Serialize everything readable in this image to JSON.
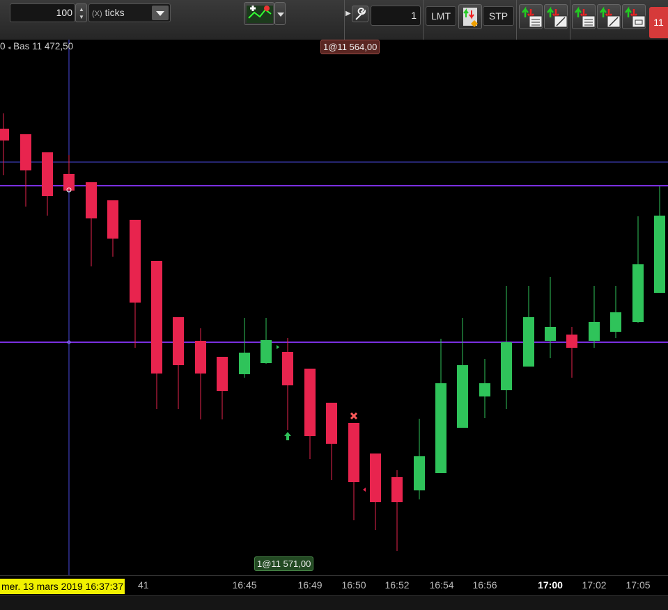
{
  "toolbar": {
    "quantity_value": "100",
    "unit_label": "ticks",
    "unit_prefix": "(X)",
    "order_qty": "1",
    "lmt_label": "LMT",
    "stp_label": "STP",
    "badge": "11",
    "colors": {
      "badge": "#d63a3a"
    }
  },
  "chart": {
    "header": "Bas 11 472,50",
    "header_prefix": "0",
    "order_top": "1@11 564,00",
    "order_bottom": "1@11 571,00",
    "cursor_time": "mer. 13 mars 2019 16:37:37",
    "cursor_time_suffix": "41",
    "colors": {
      "up": "#2fc35a",
      "down": "#e8244e",
      "hline": "#7a2fe0",
      "crosshair": "#4a4ae0"
    }
  },
  "axis": {
    "ticks": [
      "16:45",
      "16:49",
      "16:50",
      "16:52",
      "16:54",
      "16:56",
      "17:00",
      "17:02",
      "17:05"
    ],
    "bold_tick": "17:00"
  }
}
